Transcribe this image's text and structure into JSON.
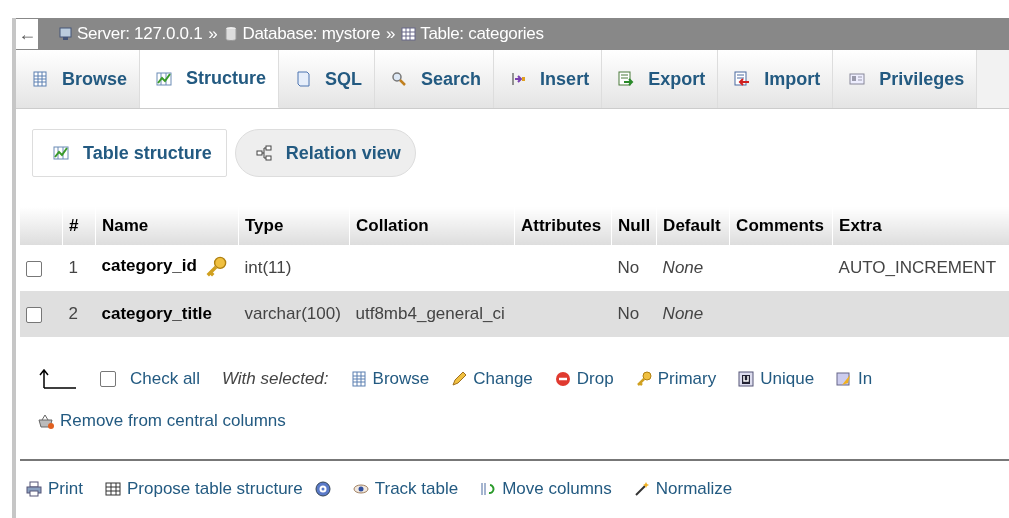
{
  "breadcrumb": {
    "back": "←",
    "items": [
      {
        "kind": "server",
        "text": "Server: 127.0.0.1"
      },
      {
        "kind": "separator",
        "text": "»"
      },
      {
        "kind": "database",
        "text": "Database: mystore"
      },
      {
        "kind": "separator",
        "text": "»"
      },
      {
        "kind": "table",
        "text": "Table: categories"
      }
    ]
  },
  "tabs": [
    {
      "label": "Browse",
      "kind": "grid",
      "selected": false
    },
    {
      "label": "Structure",
      "kind": "structure",
      "selected": true
    },
    {
      "label": "SQL",
      "kind": "sql",
      "selected": false
    },
    {
      "label": "Search",
      "kind": "search",
      "selected": false
    },
    {
      "label": "Insert",
      "kind": "insert",
      "selected": false
    },
    {
      "label": "Export",
      "kind": "export",
      "selected": false
    },
    {
      "label": "Import",
      "kind": "import",
      "selected": false
    },
    {
      "label": "Privileges",
      "kind": "card",
      "selected": false
    }
  ],
  "subtabs": [
    {
      "label": "Table structure",
      "kind": "structure",
      "selected": true
    },
    {
      "label": "Relation view",
      "kind": "relation",
      "selected": false
    }
  ],
  "table": {
    "columns": [
      "#",
      "Name",
      "Type",
      "Collation",
      "Attributes",
      "Null",
      "Default",
      "Comments",
      "Extra"
    ],
    "rows": [
      {
        "checked": false,
        "primary": true,
        "cells": [
          "1",
          "category_id",
          "int(11)",
          "",
          "",
          "No",
          "None",
          "",
          "AUTO_INCREMENT"
        ]
      },
      {
        "checked": false,
        "primary": false,
        "cells": [
          "2",
          "category_title",
          "varchar(100)",
          "utf8mb4_general_ci",
          "",
          "No",
          "None",
          "",
          ""
        ]
      }
    ]
  },
  "bulk_actions": {
    "check_all": {
      "label": "Check all",
      "checked": false
    },
    "with_selected": "With selected:",
    "actions": [
      {
        "label": "Browse",
        "kind": "grid"
      },
      {
        "label": "Change",
        "kind": "pencil"
      },
      {
        "label": "Drop",
        "kind": "drop"
      },
      {
        "label": "Primary",
        "kind": "key"
      },
      {
        "label": "Unique",
        "kind": "unique"
      },
      {
        "label": "In",
        "kind": "index"
      },
      {
        "label": "Remove from central columns",
        "kind": "basket"
      }
    ]
  },
  "footer_links": [
    {
      "label": "Print",
      "kind": "print",
      "help": false
    },
    {
      "label": "Propose table structure",
      "kind": "propose",
      "help": true
    },
    {
      "label": "Track table",
      "kind": "eye",
      "help": false
    },
    {
      "label": "Move columns",
      "kind": "move",
      "help": false
    },
    {
      "label": "Normalize",
      "kind": "wand",
      "help": false
    }
  ]
}
